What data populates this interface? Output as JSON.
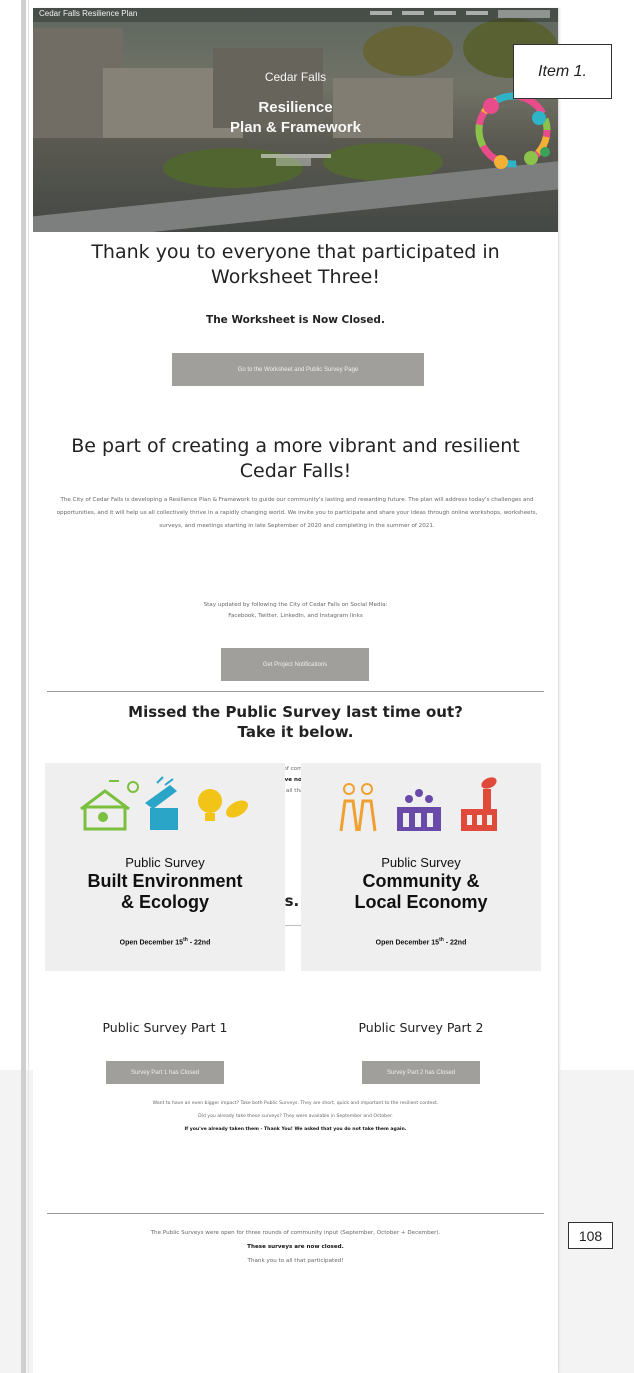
{
  "item_label": "Item 1.",
  "page_number": "108",
  "hero": {
    "brand": "Cedar Falls Resilience Plan",
    "city": "Cedar Falls",
    "title_line1": "Resilience",
    "title_line2": "Plan & Framework"
  },
  "thanks": {
    "line1": "Thank you to everyone that participated in",
    "line2": "Worksheet Three!",
    "closed": "The Worksheet is Now Closed.",
    "button": "Go to the Worksheet and Public Survey Page"
  },
  "vibrant": {
    "line1": "Be part of creating a more vibrant and resilient",
    "line2": "Cedar Falls!",
    "para": "The City of Cedar Falls is developing a Resilience Plan & Framework to guide our community's lasting and rewarding future. The plan will address today's challenges and opportunities, and it will help us all collectively thrive in a rapidly changing world. We invite you to participate and share your ideas through online workshops, worksheets, surveys, and meetings starting in late September of 2020 and completing in the summer of 2021.",
    "social1": "Stay updated by following the City of Cedar Falls on Social Media:",
    "social2": "Facebook, Twitter, LinkedIn, and Instagram links",
    "button": "Get Project Notifications"
  },
  "missed": {
    "line1": "Missed the Public Survey last time out?",
    "line2": "Take it below.",
    "p1": "The Public Surveys were open for three rounds of community input (September, October + December).",
    "p2": "They have now closed.",
    "p3": "Thank you to all that participated!"
  },
  "help": "Help shape Cedar Falls. Help shape the world.",
  "cards": [
    {
      "pretitle": "Public Survey",
      "title1": "Built Environment",
      "title2": "& Ecology",
      "dates_pre": "Open December 15",
      "dates_sup": "th",
      "dates_post": " - 22nd",
      "part": "Public Survey Part 1",
      "button": "Survey Part 1 has Closed"
    },
    {
      "pretitle": "Public Survey",
      "title1": "Community &",
      "title2": "Local Economy",
      "dates_pre": "Open December 15",
      "dates_sup": "th",
      "dates_post": " - 22nd",
      "part": "Public Survey Part 2",
      "button": "Survey Part 2 has Closed"
    }
  ],
  "notes": {
    "n1": "Want to have an even bigger impact? Take both Public Surveys. They are short, quick and important to the resilient context.",
    "n2": "Did you already take these surveys? They were available in September and October.",
    "n3": "If you've already taken them - Thank You! We asked that you do not take them again."
  },
  "footer": {
    "p1": "The Public Surveys were open for three rounds of community input (September, October + December).",
    "p2": "These surveys are now closed.",
    "p3": "Thank you to all that participated!"
  }
}
